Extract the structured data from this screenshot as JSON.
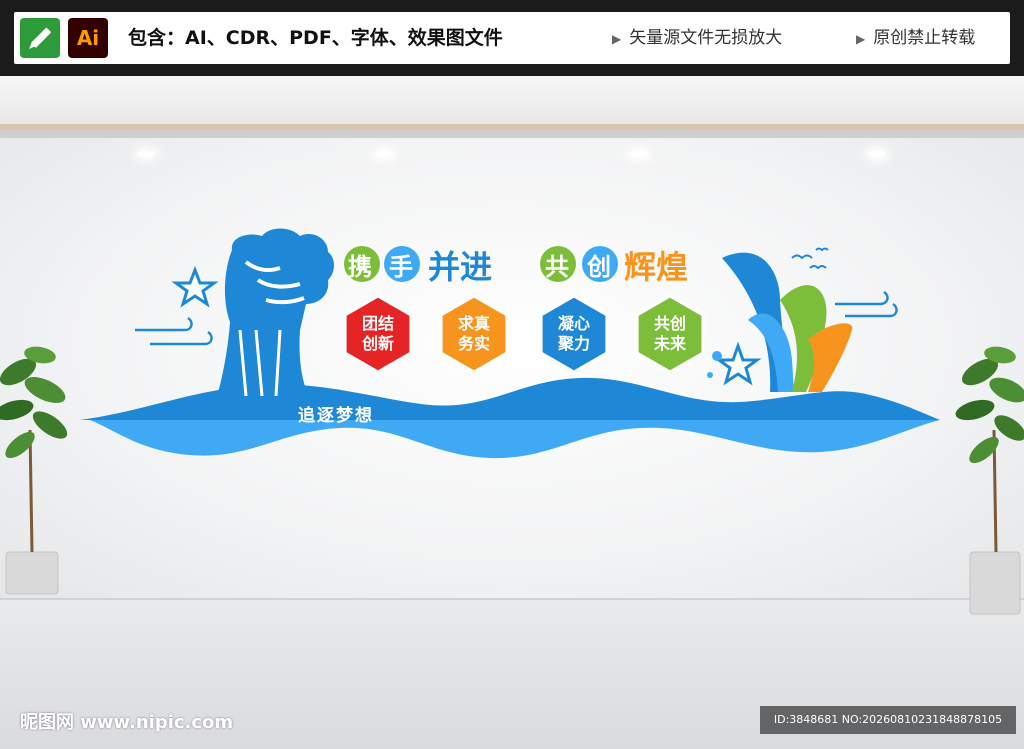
{
  "header": {
    "contains_text": "包含：AI、CDR、PDF、字体、效果图文件",
    "ai_label": "Ai",
    "tag_vector": "矢量源文件无损放大",
    "tag_original": "原创禁止转载",
    "tri_glyph": "▶"
  },
  "mural": {
    "title_left": [
      "携",
      "手",
      "并进"
    ],
    "title_right": [
      "共",
      "创",
      "辉煌"
    ],
    "values": [
      {
        "line1": "团结",
        "line2": "创新",
        "color": "#e52525"
      },
      {
        "line1": "求真",
        "line2": "务实",
        "color": "#f7941d"
      },
      {
        "line1": "凝心",
        "line2": "聚力",
        "color": "#1e88d6"
      },
      {
        "line1": "共创",
        "line2": "未来",
        "color": "#7cbd3a"
      }
    ],
    "slogan": "追逐梦想",
    "colors": {
      "blue": "#1e88d6",
      "light_blue": "#3fa9f5",
      "green": "#7cbd3a",
      "orange": "#f7941d",
      "red": "#e52525"
    }
  },
  "watermark": {
    "site": "昵图网 www.nipic.com",
    "id": "ID:3848681 NO:20260810231848878105"
  }
}
